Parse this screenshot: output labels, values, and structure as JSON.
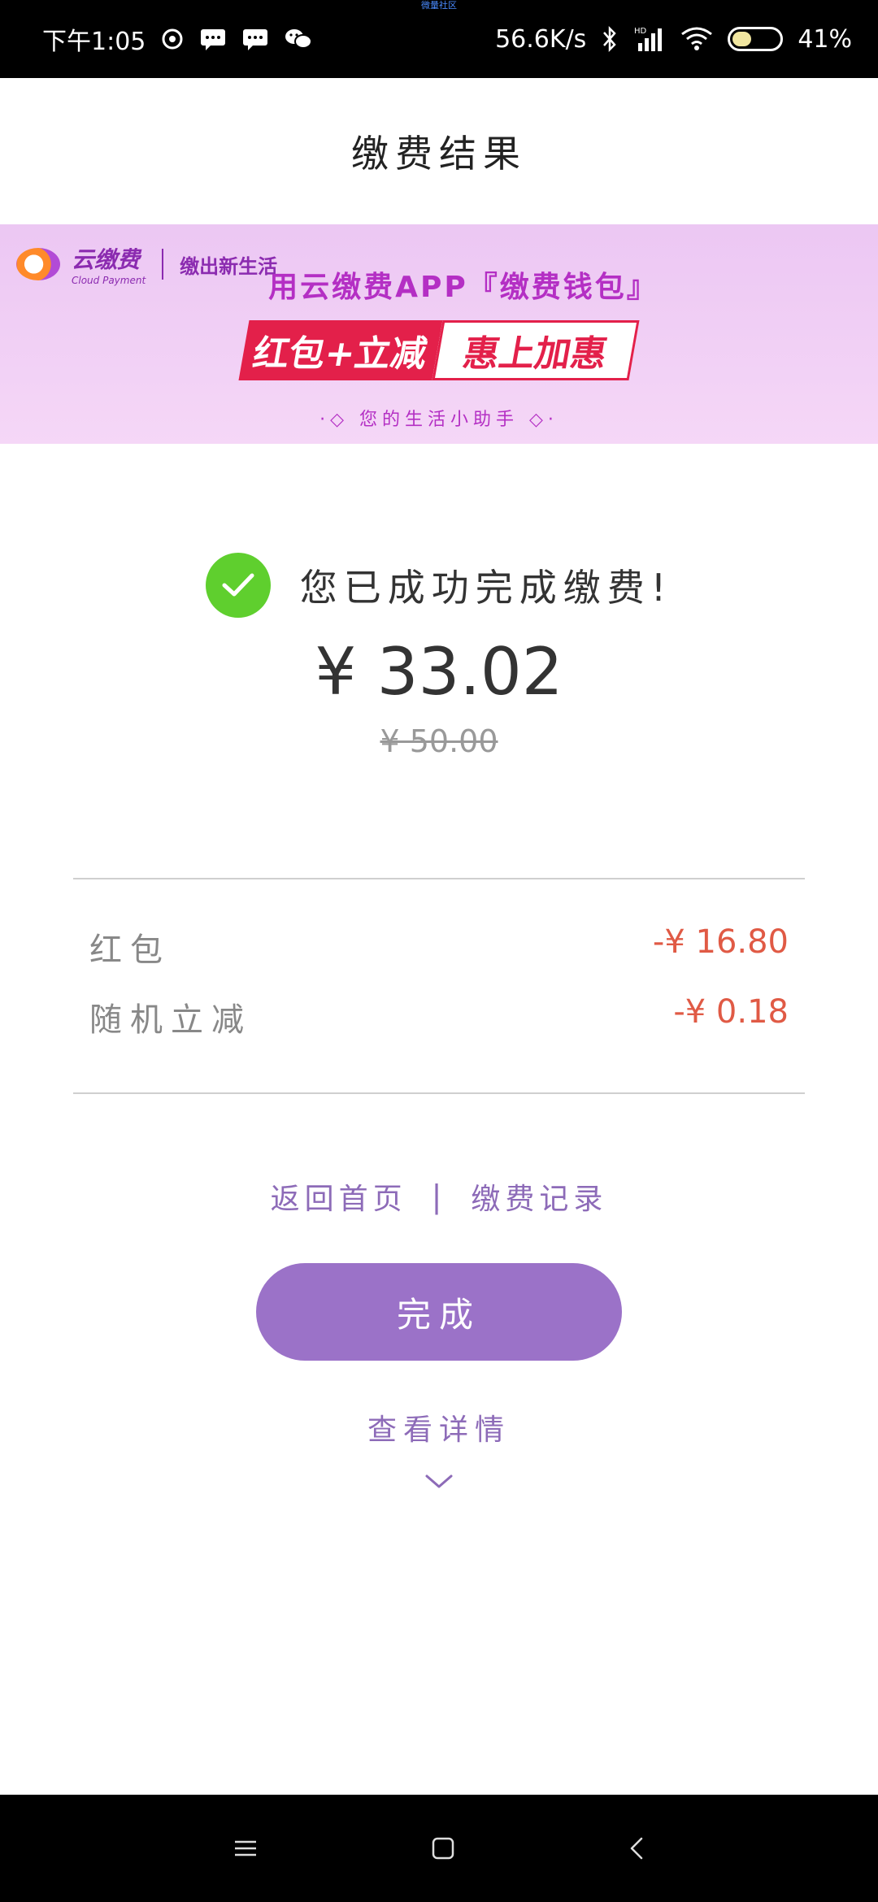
{
  "status_bar": {
    "time": "下午1:05",
    "top_hint": "微量社区",
    "network_speed": "56.6K/s",
    "battery_percent": "41%",
    "battery_level": 0.41,
    "left_icons": [
      "netease-music-icon",
      "sms-icon",
      "sms-icon",
      "wechat-icon"
    ],
    "right_icons": [
      "bluetooth-icon",
      "hd-signal-icon",
      "wifi-icon",
      "battery-icon"
    ]
  },
  "header": {
    "title": "缴费结果"
  },
  "banner": {
    "brand_cn": "云缴费",
    "brand_en": "Cloud Payment",
    "slogan": "缴出新生活",
    "line1": "用云缴费APP『缴费钱包』",
    "promo_left": "红包+立减",
    "promo_right": "惠上加惠",
    "line3": "·◇ 您的生活小助手 ◇·"
  },
  "result": {
    "success_text": "您已成功完成缴费!",
    "amount": "¥ 33.02",
    "original_amount": "¥ 50.00"
  },
  "discounts": [
    {
      "label": "红包",
      "value": "-¥ 16.80"
    },
    {
      "label": "随机立减",
      "value": "-¥ 0.18"
    }
  ],
  "links": {
    "home": "返回首页",
    "separator": "|",
    "records": "缴费记录"
  },
  "done_button": {
    "label": "完成"
  },
  "detail": {
    "label": "查看详情"
  },
  "colors": {
    "accent": "#9b72c8",
    "link": "#8d6bb8",
    "success_green": "#5fcf2e",
    "discount_red": "#e05a45",
    "banner_bg": "#ecc7f3"
  }
}
